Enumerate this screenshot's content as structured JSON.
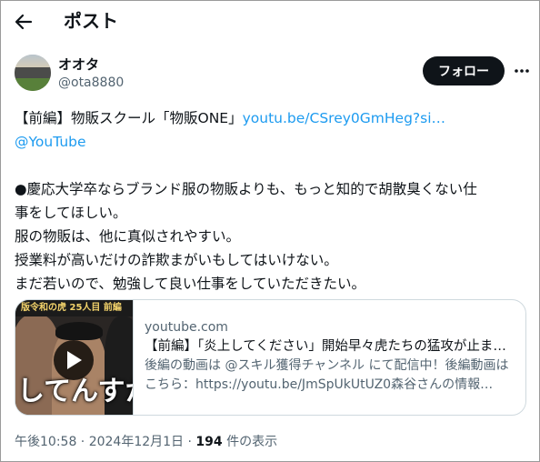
{
  "header": {
    "title": "ポスト",
    "back_icon": "arrow-left-icon"
  },
  "author": {
    "display_name": "オオタ",
    "handle": "@ota8880",
    "follow_label": "フォロー",
    "more_icon": "more-dots-icon"
  },
  "tweet": {
    "line1_prefix": "【前編】物販スクール「物販ONE」",
    "line1_link": "youtu.be/CSrey0GmHeg?si…",
    "line2_link": "@YouTube",
    "line3": "●慶応大学卒ならブランド服の物販よりも、もっと知的で胡散臭くない仕",
    "line4": "事をしてほしい。",
    "line5": "服の物販は、他に真似されやすい。",
    "line6": "授業料が高いだけの詐欺まがいもしてはいけない。",
    "line7": "まだ若いので、勉強して良い仕事をしていただきたい。"
  },
  "card": {
    "thumb_banner": "版令和の虎 25人目 前編",
    "thumb_caption": "してんすか",
    "play_icon": "play-icon",
    "domain": "youtube.com",
    "title": "【前編】「炎上してください」開始早々虎たちの猛攻が止ま…",
    "description": "後編の動画は @スキル獲得チャンネル にて配信中！後編動画はこちら：https://youtu.be/JmSpUkUtUZ0森谷さんの情報…"
  },
  "meta": {
    "timestamp": "午後10:58 · 2024年12月1日",
    "separator": "·",
    "views_count": "194",
    "views_label": "件の表示"
  },
  "colors": {
    "link": "#1d9bf0",
    "text": "#0f1419",
    "muted": "#536471",
    "button_bg": "#0f1419",
    "border": "#cfd9de"
  }
}
